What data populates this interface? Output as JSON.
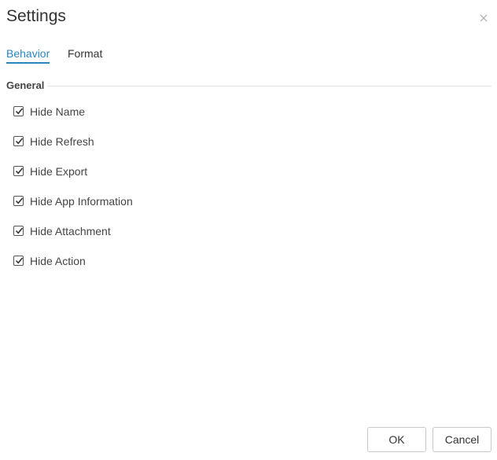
{
  "dialog": {
    "title": "Settings",
    "close_icon": "close-icon"
  },
  "tabs": [
    {
      "label": "Behavior",
      "active": true
    },
    {
      "label": "Format",
      "active": false
    }
  ],
  "group": {
    "title": "General"
  },
  "options": [
    {
      "label": "Hide Name",
      "checked": true
    },
    {
      "label": "Hide Refresh",
      "checked": true
    },
    {
      "label": "Hide Export",
      "checked": true
    },
    {
      "label": "Hide App Information",
      "checked": true
    },
    {
      "label": "Hide Attachment",
      "checked": true
    },
    {
      "label": "Hide Action",
      "checked": true
    }
  ],
  "footer": {
    "ok_label": "OK",
    "cancel_label": "Cancel"
  },
  "colors": {
    "accent": "#2a86c1"
  }
}
